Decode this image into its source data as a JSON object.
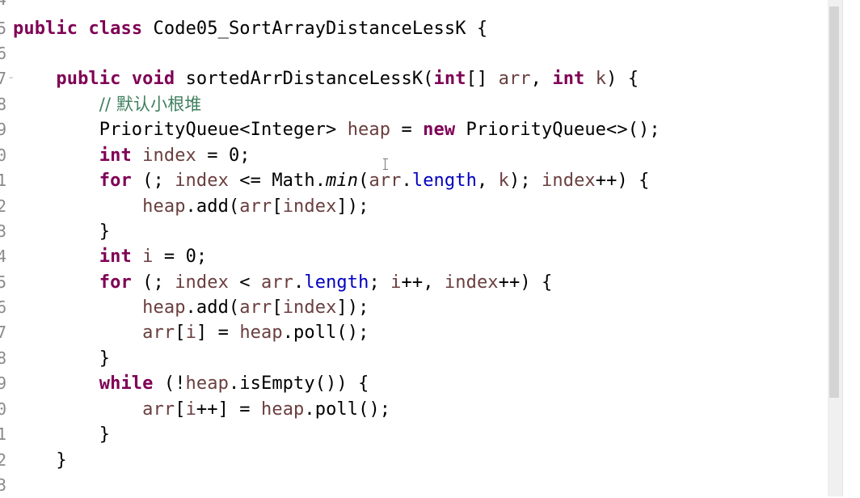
{
  "gutter": {
    "line_numbers": [
      "4",
      "5",
      "6",
      "7",
      "8",
      "9",
      "0",
      "1",
      "2",
      "3",
      "4",
      "5",
      "6",
      "7",
      "8",
      "9",
      "0",
      "1",
      "2",
      "3"
    ]
  },
  "code": {
    "l5": {
      "kw1": "public",
      "kw2": "class",
      "t1": "Code05_SortArrayDistanceLessK {"
    },
    "l7": {
      "kw1": "public",
      "kw2": "void",
      "t1": "sortedArrDistanceLessK(",
      "kw3": "int",
      "t2": "[] ",
      "v1": "arr",
      "t3": ", ",
      "kw4": "int",
      "t4": " ",
      "v2": "k",
      "t5": ") {"
    },
    "l8": {
      "comment": "// 默认小根堆"
    },
    "l9": {
      "t1": "PriorityQueue<Integer> ",
      "v1": "heap",
      "t2": " = ",
      "kw1": "new",
      "t3": " PriorityQueue<>();"
    },
    "l10": {
      "kw1": "int",
      "t1": " ",
      "v1": "index",
      "t2": " = 0;"
    },
    "l11": {
      "kw1": "for",
      "t1": " (; ",
      "v1": "index",
      "t2": " <= Math.",
      "m1": "min",
      "t3": "(",
      "v2": "arr",
      "t4": ".",
      "f1": "length",
      "t5": ", ",
      "v3": "k",
      "t6": "); ",
      "v4": "index",
      "t7": "++) {"
    },
    "l12": {
      "v1": "heap",
      "t1": ".add(",
      "v2": "arr",
      "t2": "[",
      "v3": "index",
      "t3": "]);"
    },
    "l13": {
      "t1": "}"
    },
    "l14": {
      "kw1": "int",
      "t1": " ",
      "v1": "i",
      "t2": " = 0;"
    },
    "l15": {
      "kw1": "for",
      "t1": " (; ",
      "v1": "index",
      "t2": " < ",
      "v2": "arr",
      "t3": ".",
      "f1": "length",
      "t4": "; ",
      "v3": "i",
      "t5": "++, ",
      "v4": "index",
      "t6": "++) {"
    },
    "l16": {
      "v1": "heap",
      "t1": ".add(",
      "v2": "arr",
      "t2": "[",
      "v3": "index",
      "t3": "]);"
    },
    "l17": {
      "v1": "arr",
      "t1": "[",
      "v2": "i",
      "t2": "] = ",
      "v3": "heap",
      "t3": ".poll();"
    },
    "l18": {
      "t1": "}"
    },
    "l19": {
      "kw1": "while",
      "t1": " (!",
      "v1": "heap",
      "t2": ".isEmpty()) {"
    },
    "l20": {
      "v1": "arr",
      "t1": "[",
      "v2": "i",
      "t2": "++] = ",
      "v3": "heap",
      "t3": ".poll();"
    },
    "l21": {
      "t1": "}"
    },
    "l22": {
      "t1": "}"
    }
  },
  "colors": {
    "keyword": "#7f0055",
    "local_variable": "#6a3e3e",
    "field": "#0000c0",
    "comment": "#3f7f5f",
    "text": "#000000",
    "gutter": "#8a8a8a"
  }
}
